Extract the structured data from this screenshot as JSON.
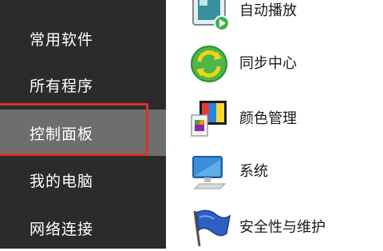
{
  "sidebar": {
    "items": [
      {
        "label": "常用软件"
      },
      {
        "label": "所有程序"
      },
      {
        "label": "控制面板"
      },
      {
        "label": "我的电脑"
      },
      {
        "label": "网络连接"
      }
    ]
  },
  "panel": {
    "items": [
      {
        "label": "自动播放",
        "icon": "autoplay-icon"
      },
      {
        "label": "同步中心",
        "icon": "sync-center-icon"
      },
      {
        "label": "颜色管理",
        "icon": "color-management-icon"
      },
      {
        "label": "系统",
        "icon": "system-icon"
      },
      {
        "label": "安全性与维护",
        "icon": "security-flag-icon"
      }
    ]
  },
  "colors": {
    "sidebar_bg": "#2b2b2b",
    "active_item_bg": "#6e6e6e",
    "highlight": "#e0302b"
  }
}
